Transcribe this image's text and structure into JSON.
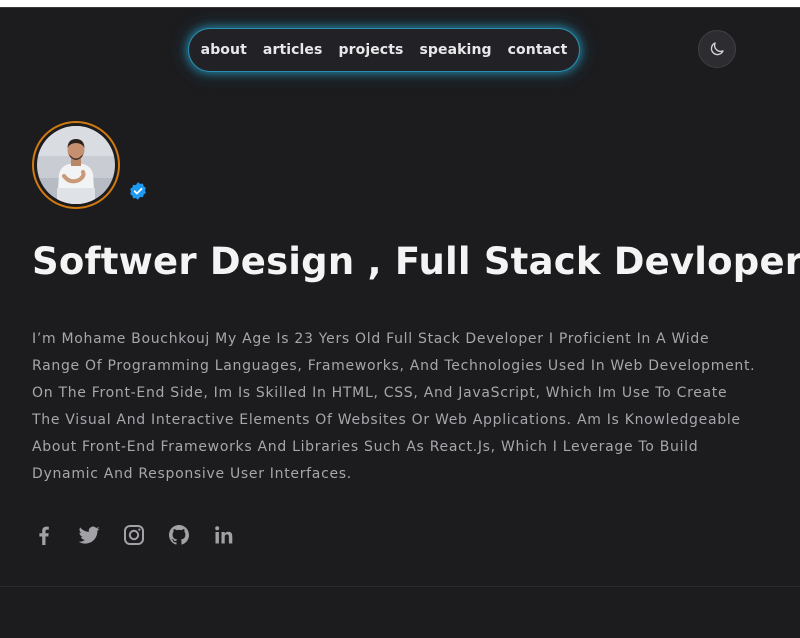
{
  "nav": {
    "items": [
      {
        "label": "about"
      },
      {
        "label": "articles"
      },
      {
        "label": "projects"
      },
      {
        "label": "speaking"
      },
      {
        "label": "contact"
      }
    ]
  },
  "theme_toggle": {
    "icon": "moon-icon"
  },
  "profile": {
    "avatar_border_color": "#d07a10",
    "verified_color": "#1d9bf0",
    "headline": "Softwer Design , Full Stack Devloper",
    "bio": "I’m Mohame Bouchkouj My Age Is 23 Yers Old Full Stack Developer I Proficient In A Wide Range Of Programming Languages, Frameworks, And Technologies Used In Web Development. On The Front-End Side, Im Is Skilled In HTML, CSS, And JavaScript, Which Im Use To Create The Visual And Interactive Elements Of Websites Or Web Applications. Am Is Knowledgeable About Front-End Frameworks And Libraries Such As React.Js, Which I Leverage To Build Dynamic And Responsive User Interfaces."
  },
  "socials": [
    {
      "icon": "facebook-icon"
    },
    {
      "icon": "twitter-icon"
    },
    {
      "icon": "instagram-icon"
    },
    {
      "icon": "github-icon"
    },
    {
      "icon": "linkedin-icon"
    }
  ],
  "colors": {
    "background": "#1c1c1f",
    "nav_glow": "#2a8fb0",
    "headline": "#f4f4f5",
    "body_text": "#a6a6ab"
  }
}
